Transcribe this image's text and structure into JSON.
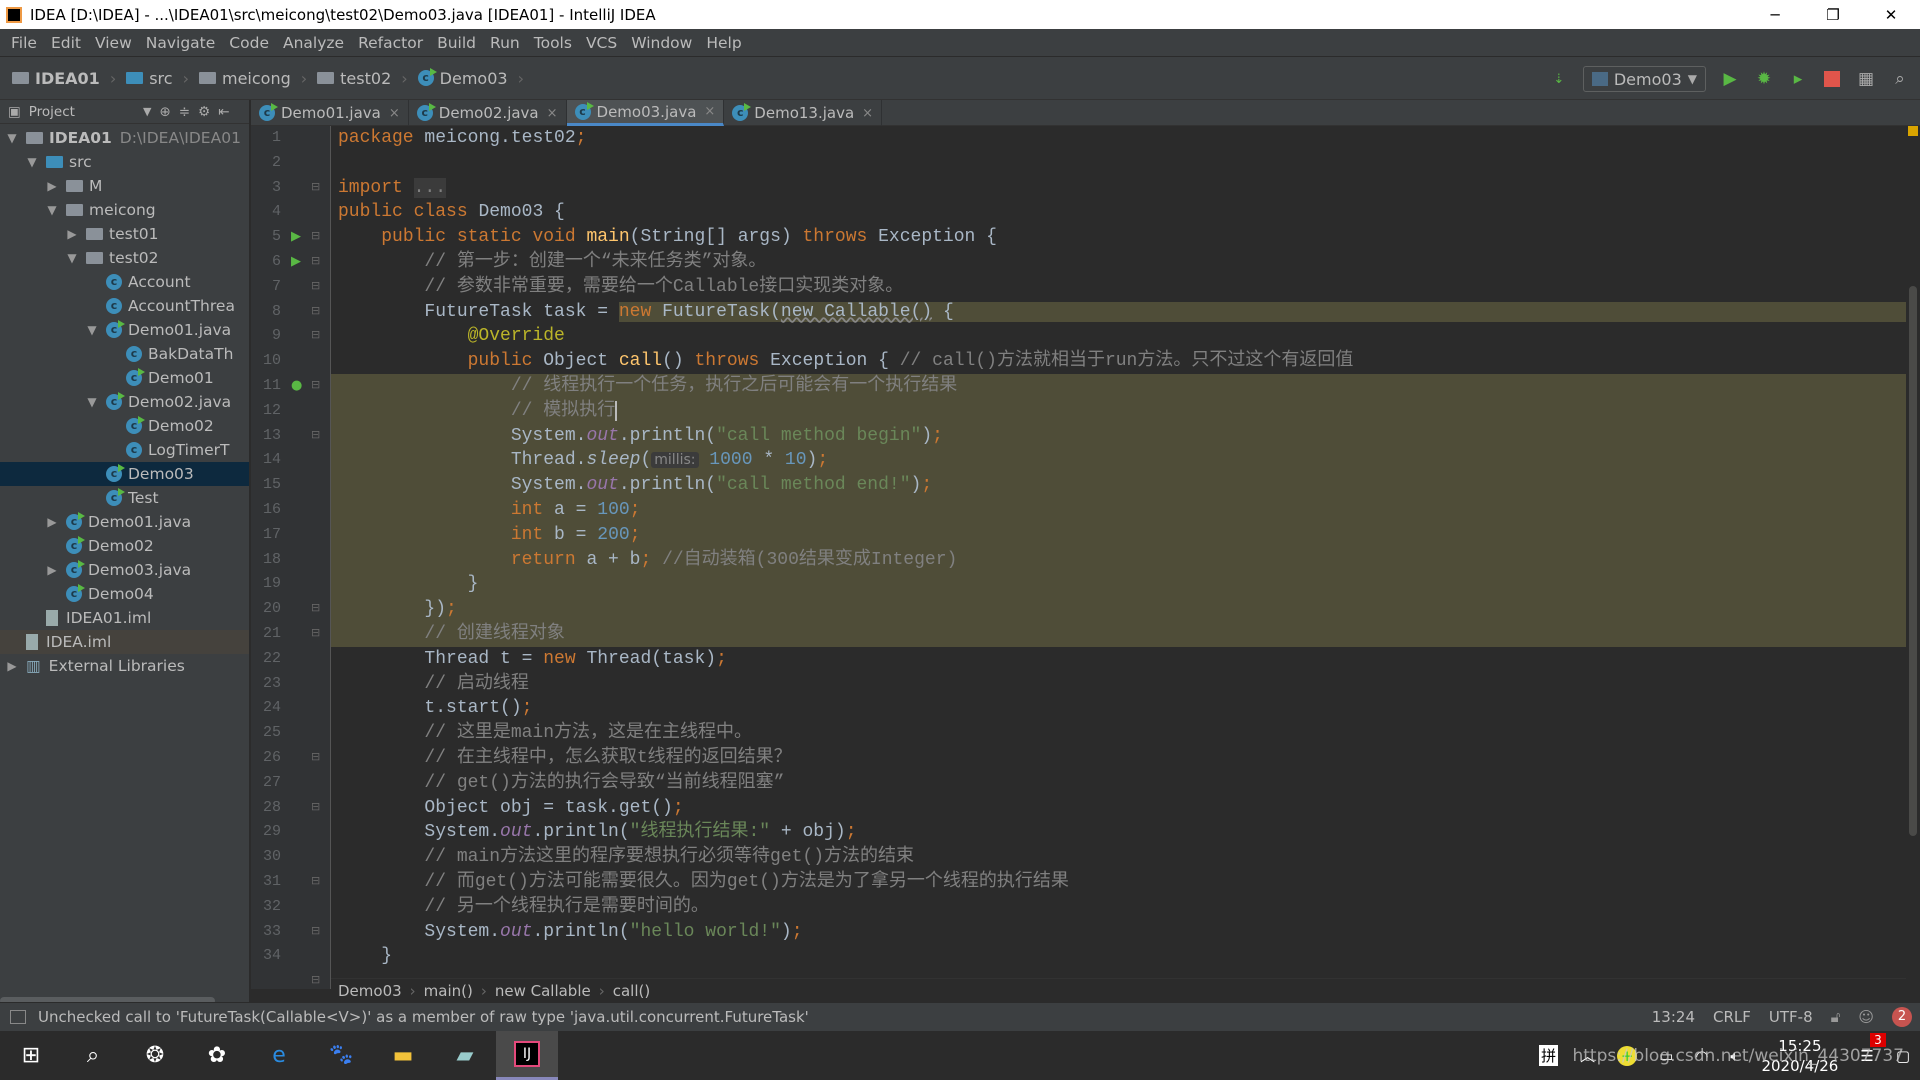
{
  "window": {
    "title": "IDEA [D:\\IDEA] - ...\\IDEA01\\src\\meicong\\test02\\Demo03.java [IDEA01] - IntelliJ IDEA",
    "minimize": "─",
    "restore": "❐",
    "close": "✕"
  },
  "menu": [
    "File",
    "Edit",
    "View",
    "Navigate",
    "Code",
    "Analyze",
    "Refactor",
    "Build",
    "Run",
    "Tools",
    "VCS",
    "Window",
    "Help"
  ],
  "nav": {
    "crumbs": [
      "IDEA01",
      "src",
      "meicong",
      "test02",
      "Demo03"
    ],
    "run_config": "Demo03"
  },
  "project": {
    "title": "Project",
    "tree": [
      {
        "label": "IDEA01",
        "extra": "D:\\IDEA\\IDEA01",
        "depth": 0,
        "arrow": "▼",
        "icon": "module",
        "bold": true
      },
      {
        "label": "src",
        "depth": 1,
        "arrow": "▼",
        "icon": "src-folder"
      },
      {
        "label": "M",
        "depth": 2,
        "arrow": "▶",
        "icon": "package"
      },
      {
        "label": "meicong",
        "depth": 2,
        "arrow": "▼",
        "icon": "package"
      },
      {
        "label": "test01",
        "depth": 3,
        "arrow": "▶",
        "icon": "package"
      },
      {
        "label": "test02",
        "depth": 3,
        "arrow": "▼",
        "icon": "package"
      },
      {
        "label": "Account",
        "depth": 4,
        "arrow": "",
        "icon": "class"
      },
      {
        "label": "AccountThrea",
        "depth": 4,
        "arrow": "",
        "icon": "class"
      },
      {
        "label": "Demo01.java",
        "depth": 4,
        "arrow": "▼",
        "icon": "class-run"
      },
      {
        "label": "BakDataTh",
        "depth": 5,
        "arrow": "",
        "icon": "class"
      },
      {
        "label": "Demo01",
        "depth": 5,
        "arrow": "",
        "icon": "class-run"
      },
      {
        "label": "Demo02.java",
        "depth": 4,
        "arrow": "▼",
        "icon": "class-run"
      },
      {
        "label": "Demo02",
        "depth": 5,
        "arrow": "",
        "icon": "class-run"
      },
      {
        "label": "LogTimerT",
        "depth": 5,
        "arrow": "",
        "icon": "class"
      },
      {
        "label": "Demo03",
        "depth": 4,
        "arrow": "",
        "icon": "class-run",
        "selected": true
      },
      {
        "label": "Test",
        "depth": 4,
        "arrow": "",
        "icon": "class-run"
      },
      {
        "label": "Demo01.java",
        "depth": 2,
        "arrow": "▶",
        "icon": "class-run"
      },
      {
        "label": "Demo02",
        "depth": 2,
        "arrow": "",
        "icon": "class-run"
      },
      {
        "label": "Demo03.java",
        "depth": 2,
        "arrow": "▶",
        "icon": "class-run"
      },
      {
        "label": "Demo04",
        "depth": 2,
        "arrow": "",
        "icon": "class-run"
      },
      {
        "label": "IDEA01.iml",
        "depth": 1,
        "arrow": "",
        "icon": "file"
      },
      {
        "label": "IDEA.iml",
        "depth": 0,
        "arrow": "",
        "icon": "file",
        "hl": true
      },
      {
        "label": "External Libraries",
        "depth": 0,
        "arrow": "▶",
        "icon": "library"
      }
    ]
  },
  "tabs": [
    {
      "label": "Demo01.java"
    },
    {
      "label": "Demo02.java"
    },
    {
      "label": "Demo03.java",
      "active": true
    },
    {
      "label": "Demo13.java"
    }
  ],
  "code": [
    [
      [
        "kw",
        "package "
      ],
      [
        "pl",
        "meicong.test02"
      ],
      [
        "kw",
        ";"
      ]
    ],
    [],
    [
      [
        "kw",
        "import "
      ],
      [
        "cm fold-imp",
        "..."
      ]
    ],
    [
      [
        "kw",
        "public class "
      ],
      [
        "pl",
        "Demo03 {"
      ]
    ],
    [
      [
        "pl",
        "    "
      ],
      [
        "kw",
        "public static void "
      ],
      [
        "fn",
        "main"
      ],
      [
        "pl",
        "(String[] args) "
      ],
      [
        "kw",
        "throws "
      ],
      [
        "pl",
        "Exception {"
      ]
    ],
    [
      [
        "cm",
        "        // 第一步：创建一个“未来任务类”对象。"
      ]
    ],
    [
      [
        "cm",
        "        // 参数非常重要，需要给一个Callable接口实现类对象。"
      ]
    ],
    [
      [
        "pl",
        "        FutureTask task = "
      ],
      [
        "kw bgh",
        "new "
      ],
      [
        "pl bgh",
        "FutureTask("
      ],
      [
        "und bgh",
        "new Callable()"
      ],
      [
        "pl bgh",
        " {"
      ],
      [
        "bgh",
        "                                                                                                             "
      ]
    ],
    [
      [
        "ann",
        "            @Override"
      ]
    ],
    [
      [
        "kw",
        "            public "
      ],
      [
        "pl",
        "Object "
      ],
      [
        "fn",
        "call"
      ],
      [
        "pl",
        "() "
      ],
      [
        "kw",
        "throws "
      ],
      [
        "pl",
        "Exception { "
      ],
      [
        "cm",
        "// call()方法就相当于run方法。只不过这个有返回值"
      ]
    ],
    [
      [
        "cm",
        "                // 线程执行一个任务，执行之后可能会有一个执行结果"
      ]
    ],
    [
      [
        "cm",
        "                // 模拟执行"
      ],
      [
        "caret",
        ""
      ]
    ],
    [
      [
        "pl",
        "                System."
      ],
      [
        "fld",
        "out"
      ],
      [
        "pl",
        ".println("
      ],
      [
        "str",
        "\"call method begin\""
      ],
      [
        "pl",
        ")"
      ],
      [
        "kw",
        ";"
      ]
    ],
    [
      [
        "pl",
        "                Thread."
      ],
      [
        "it",
        "sleep"
      ],
      [
        "pl",
        "("
      ],
      [
        "hint",
        "millis:"
      ],
      [
        "num",
        " 1000"
      ],
      [
        "pl",
        " * "
      ],
      [
        "num",
        "10"
      ],
      [
        "pl",
        ")"
      ],
      [
        "kw",
        ";"
      ]
    ],
    [
      [
        "pl",
        "                System."
      ],
      [
        "fld",
        "out"
      ],
      [
        "pl",
        ".println("
      ],
      [
        "str",
        "\"call method end!\""
      ],
      [
        "pl",
        ")"
      ],
      [
        "kw",
        ";"
      ]
    ],
    [
      [
        "kw",
        "                int "
      ],
      [
        "pl",
        "a = "
      ],
      [
        "num",
        "100"
      ],
      [
        "kw",
        ";"
      ]
    ],
    [
      [
        "kw",
        "                int "
      ],
      [
        "pl",
        "b = "
      ],
      [
        "num",
        "200"
      ],
      [
        "kw",
        ";"
      ]
    ],
    [
      [
        "kw",
        "                return "
      ],
      [
        "pl",
        "a + b"
      ],
      [
        "kw",
        "; "
      ],
      [
        "cm",
        "//自动装箱(300结果变成Integer)"
      ]
    ],
    [
      [
        "pl",
        "            }"
      ]
    ],
    [
      [
        "pl bgh",
        "        })"
      ],
      [
        "kw bgh",
        ";"
      ]
    ],
    [
      [
        "cm",
        "        // 创建线程对象"
      ]
    ],
    [
      [
        "pl",
        "        Thread t = "
      ],
      [
        "kw",
        "new "
      ],
      [
        "pl",
        "Thread(task)"
      ],
      [
        "kw",
        ";"
      ]
    ],
    [
      [
        "cm",
        "        // 启动线程"
      ]
    ],
    [
      [
        "pl",
        "        t.start()"
      ],
      [
        "kw",
        ";"
      ]
    ],
    [
      [
        "cm",
        "        // 这里是main方法，这是在主线程中。"
      ]
    ],
    [
      [
        "cm",
        "        // 在主线程中，怎么获取t线程的返回结果？"
      ]
    ],
    [
      [
        "cm",
        "        // get()方法的执行会导致“当前线程阻塞”"
      ]
    ],
    [
      [
        "pl",
        "        Object obj = task.get()"
      ],
      [
        "kw",
        ";"
      ]
    ],
    [
      [
        "pl",
        "        System."
      ],
      [
        "fld",
        "out"
      ],
      [
        "pl",
        ".println("
      ],
      [
        "str",
        "\"线程执行结果:\""
      ],
      [
        "pl",
        " + obj)"
      ],
      [
        "kw",
        ";"
      ]
    ],
    [
      [
        "cm",
        "        // main方法这里的程序要想执行必须等待get()方法的结束"
      ]
    ],
    [
      [
        "cm",
        "        // 而get()方法可能需要很久。因为get()方法是为了拿另一个线程的执行结果"
      ]
    ],
    [
      [
        "cm",
        "        // 另一个线程执行是需要时间的。"
      ]
    ],
    [
      [
        "pl",
        "        System."
      ],
      [
        "fld",
        "out"
      ],
      [
        "pl",
        ".println("
      ],
      [
        "str",
        "\"hello world!\""
      ],
      [
        "pl",
        ")"
      ],
      [
        "kw",
        ";"
      ]
    ],
    [
      [
        "pl",
        "    }"
      ]
    ]
  ],
  "band_lines": [
    10,
    11,
    12,
    13,
    14,
    15,
    16,
    17,
    18,
    19,
    20
  ],
  "breadcrumb": [
    "Demo03",
    "main()",
    "new Callable",
    "call()"
  ],
  "status": {
    "message": "Unchecked call to 'FutureTask(Callable<V>)' as a member of raw type 'java.util.concurrent.FutureTask'",
    "position": "13:24",
    "line_sep": "CRLF",
    "encoding": "UTF-8",
    "notifications": "2"
  },
  "taskbar": {
    "ime": "拼",
    "time": "15:25",
    "date": "2020/4/26",
    "notif_count": "3",
    "watermark": "https://blog.csdn.net/weixin_44307737"
  }
}
